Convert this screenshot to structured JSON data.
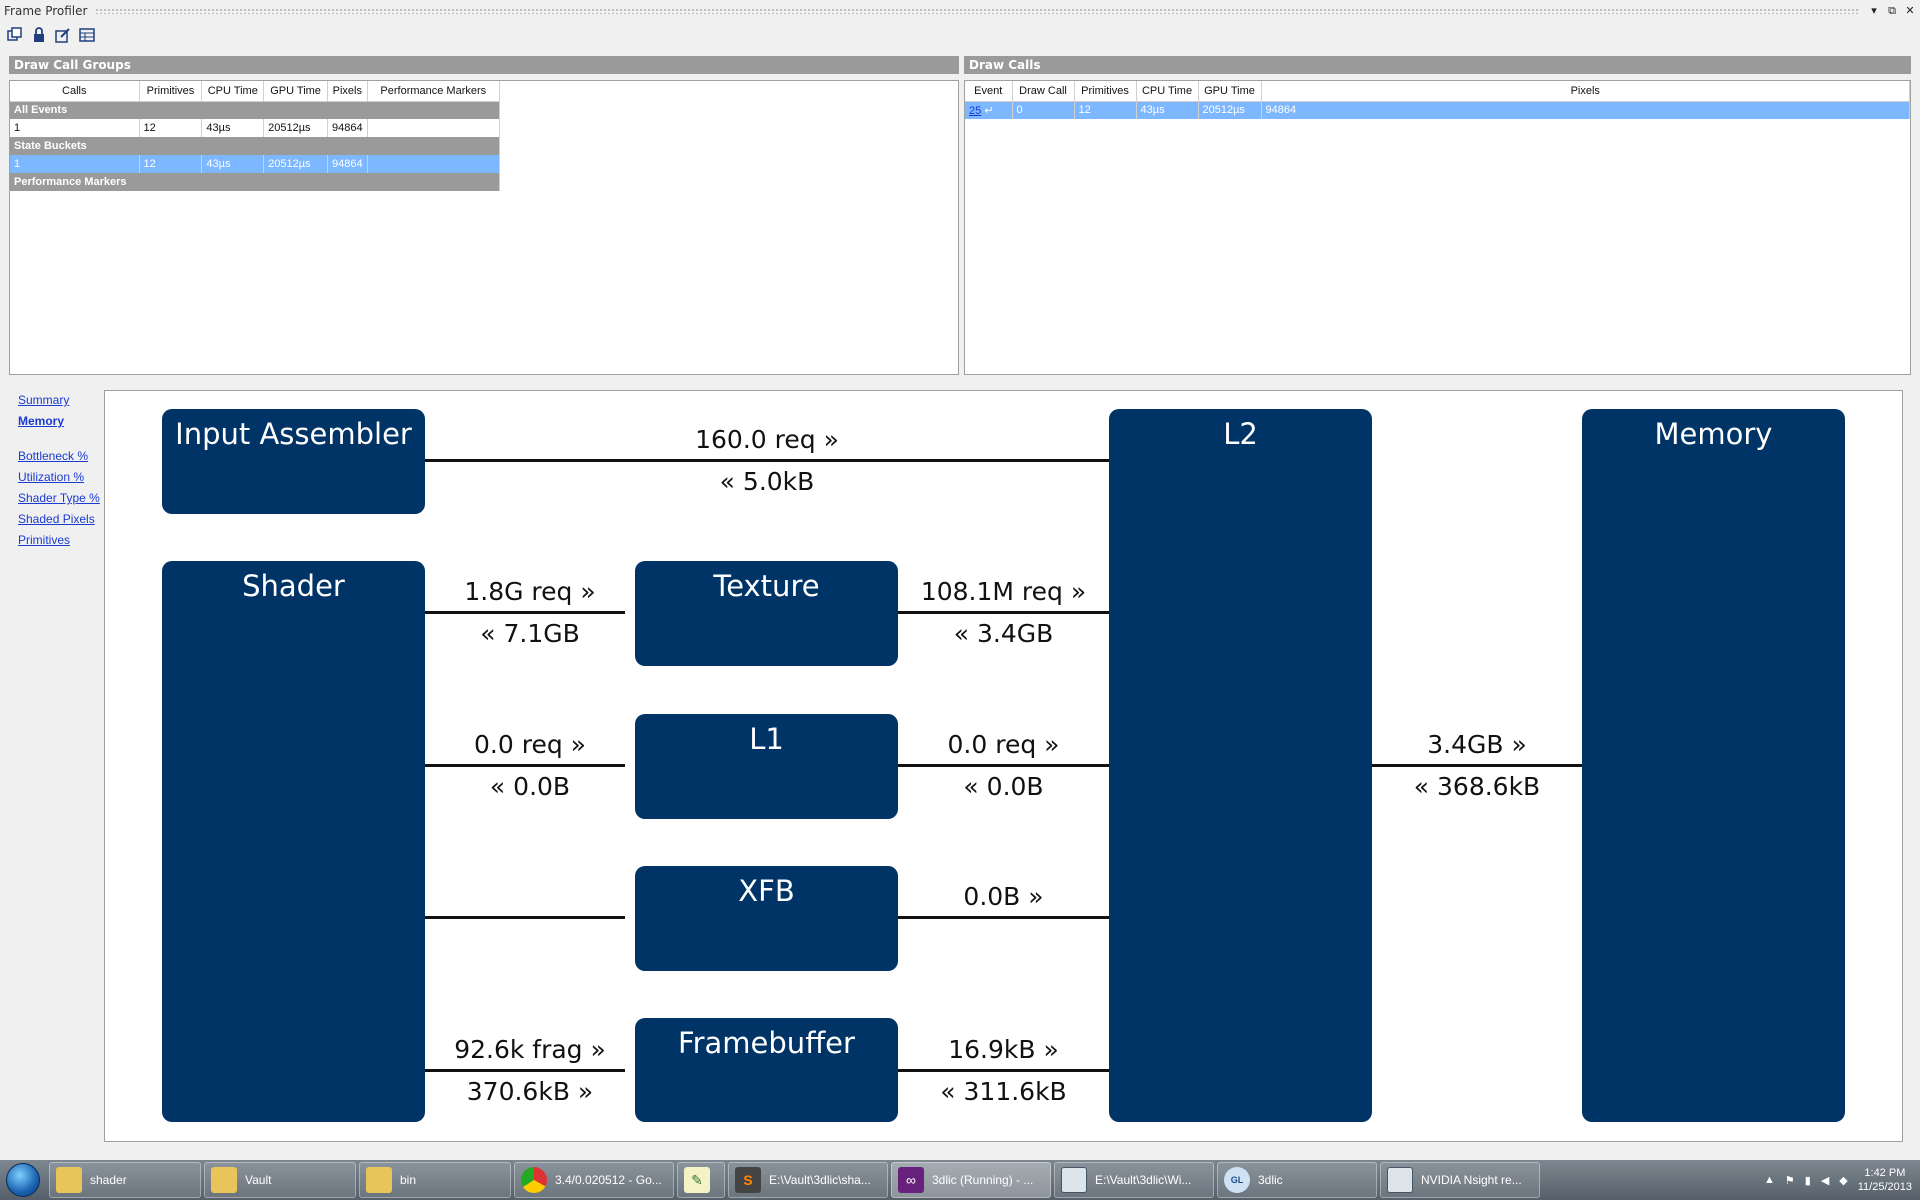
{
  "window": {
    "title": "Frame Profiler",
    "dropdown_icon": "▾",
    "restore_icon": "⧉",
    "close_icon": "✕"
  },
  "toolbar": {
    "icons": [
      "copy-icon",
      "lock-icon",
      "edit-icon",
      "table-icon"
    ]
  },
  "groups_panel": {
    "title": "Draw Call Groups",
    "columns": [
      "Calls",
      "Primitives",
      "CPU Time",
      "GPU Time",
      "Pixels",
      "Performance Markers"
    ],
    "all_events_label": "All Events",
    "all_events_row": [
      "1",
      "12",
      "43µs",
      "20512µs",
      "94864",
      ""
    ],
    "state_buckets_label": "State Buckets",
    "state_buckets_row": [
      "1",
      "12",
      "43µs",
      "20512µs",
      "94864",
      ""
    ],
    "perf_markers_label": "Performance Markers"
  },
  "calls_panel": {
    "title": "Draw Calls",
    "columns": [
      "Event",
      "Draw Call",
      "Primitives",
      "CPU Time",
      "GPU Time",
      "Pixels"
    ],
    "row": [
      "25",
      "0",
      "12",
      "43µs",
      "20512µs",
      "94864"
    ]
  },
  "sidebar": {
    "summary": "Summary",
    "memory": "Memory",
    "bottleneck": "Bottleneck %",
    "utilization": "Utilization %",
    "shader_type": "Shader Type %",
    "shaded_pixels": "Shaded Pixels",
    "primitives": "Primitives"
  },
  "diagram": {
    "boxes": {
      "input_assembler": "Input Assembler",
      "l2": "L2",
      "memory": "Memory",
      "shader": "Shader",
      "texture": "Texture",
      "l1": "L1",
      "xfb": "XFB",
      "framebuffer": "Framebuffer"
    },
    "labels": {
      "ia_req": "160.0 req »",
      "ia_ret": "« 5.0kB",
      "sh_tex_req": "1.8G req »",
      "sh_tex_ret": "« 7.1GB",
      "tex_l2_req": "108.1M req »",
      "tex_l2_ret": "« 3.4GB",
      "sh_l1_req": "0.0 req »",
      "sh_l1_ret": "« 0.0B",
      "l1_l2_req": "0.0 req »",
      "l1_l2_ret": "« 0.0B",
      "l2_mem_req": "3.4GB »",
      "l2_mem_ret": "« 368.6kB",
      "xfb_l2": "0.0B »",
      "sh_fb_frag": "92.6k frag »",
      "sh_fb_bytes": "370.6kB »",
      "fb_l2_req": "16.9kB »",
      "fb_l2_ret": "« 311.6kB"
    }
  },
  "taskbar": {
    "items": [
      {
        "label": "shader",
        "icon": "folder-icon"
      },
      {
        "label": "Vault",
        "icon": "folder-icon"
      },
      {
        "label": "bin",
        "icon": "folder-icon"
      },
      {
        "label": "3.4/0.020512 - Go...",
        "icon": "chrome-icon"
      },
      {
        "label": "",
        "icon": "notepad-icon"
      },
      {
        "label": "E:\\Vault\\3dlic\\sha...",
        "icon": "sublime-icon"
      },
      {
        "label": "3dlic (Running) - ...",
        "icon": "visual-studio-icon"
      },
      {
        "label": "E:\\Vault\\3dlic\\Wi...",
        "icon": "window-icon"
      },
      {
        "label": "3dlic",
        "icon": "opengl-icon"
      },
      {
        "label": "NVIDIA Nsight re...",
        "icon": "nsight-icon"
      }
    ],
    "time": "1:42 PM",
    "date": "11/25/2013"
  },
  "colors": {
    "box": "#003366",
    "selection": "#7cb7ff",
    "header": "#9a9a9a",
    "link": "#1a3ad0"
  }
}
